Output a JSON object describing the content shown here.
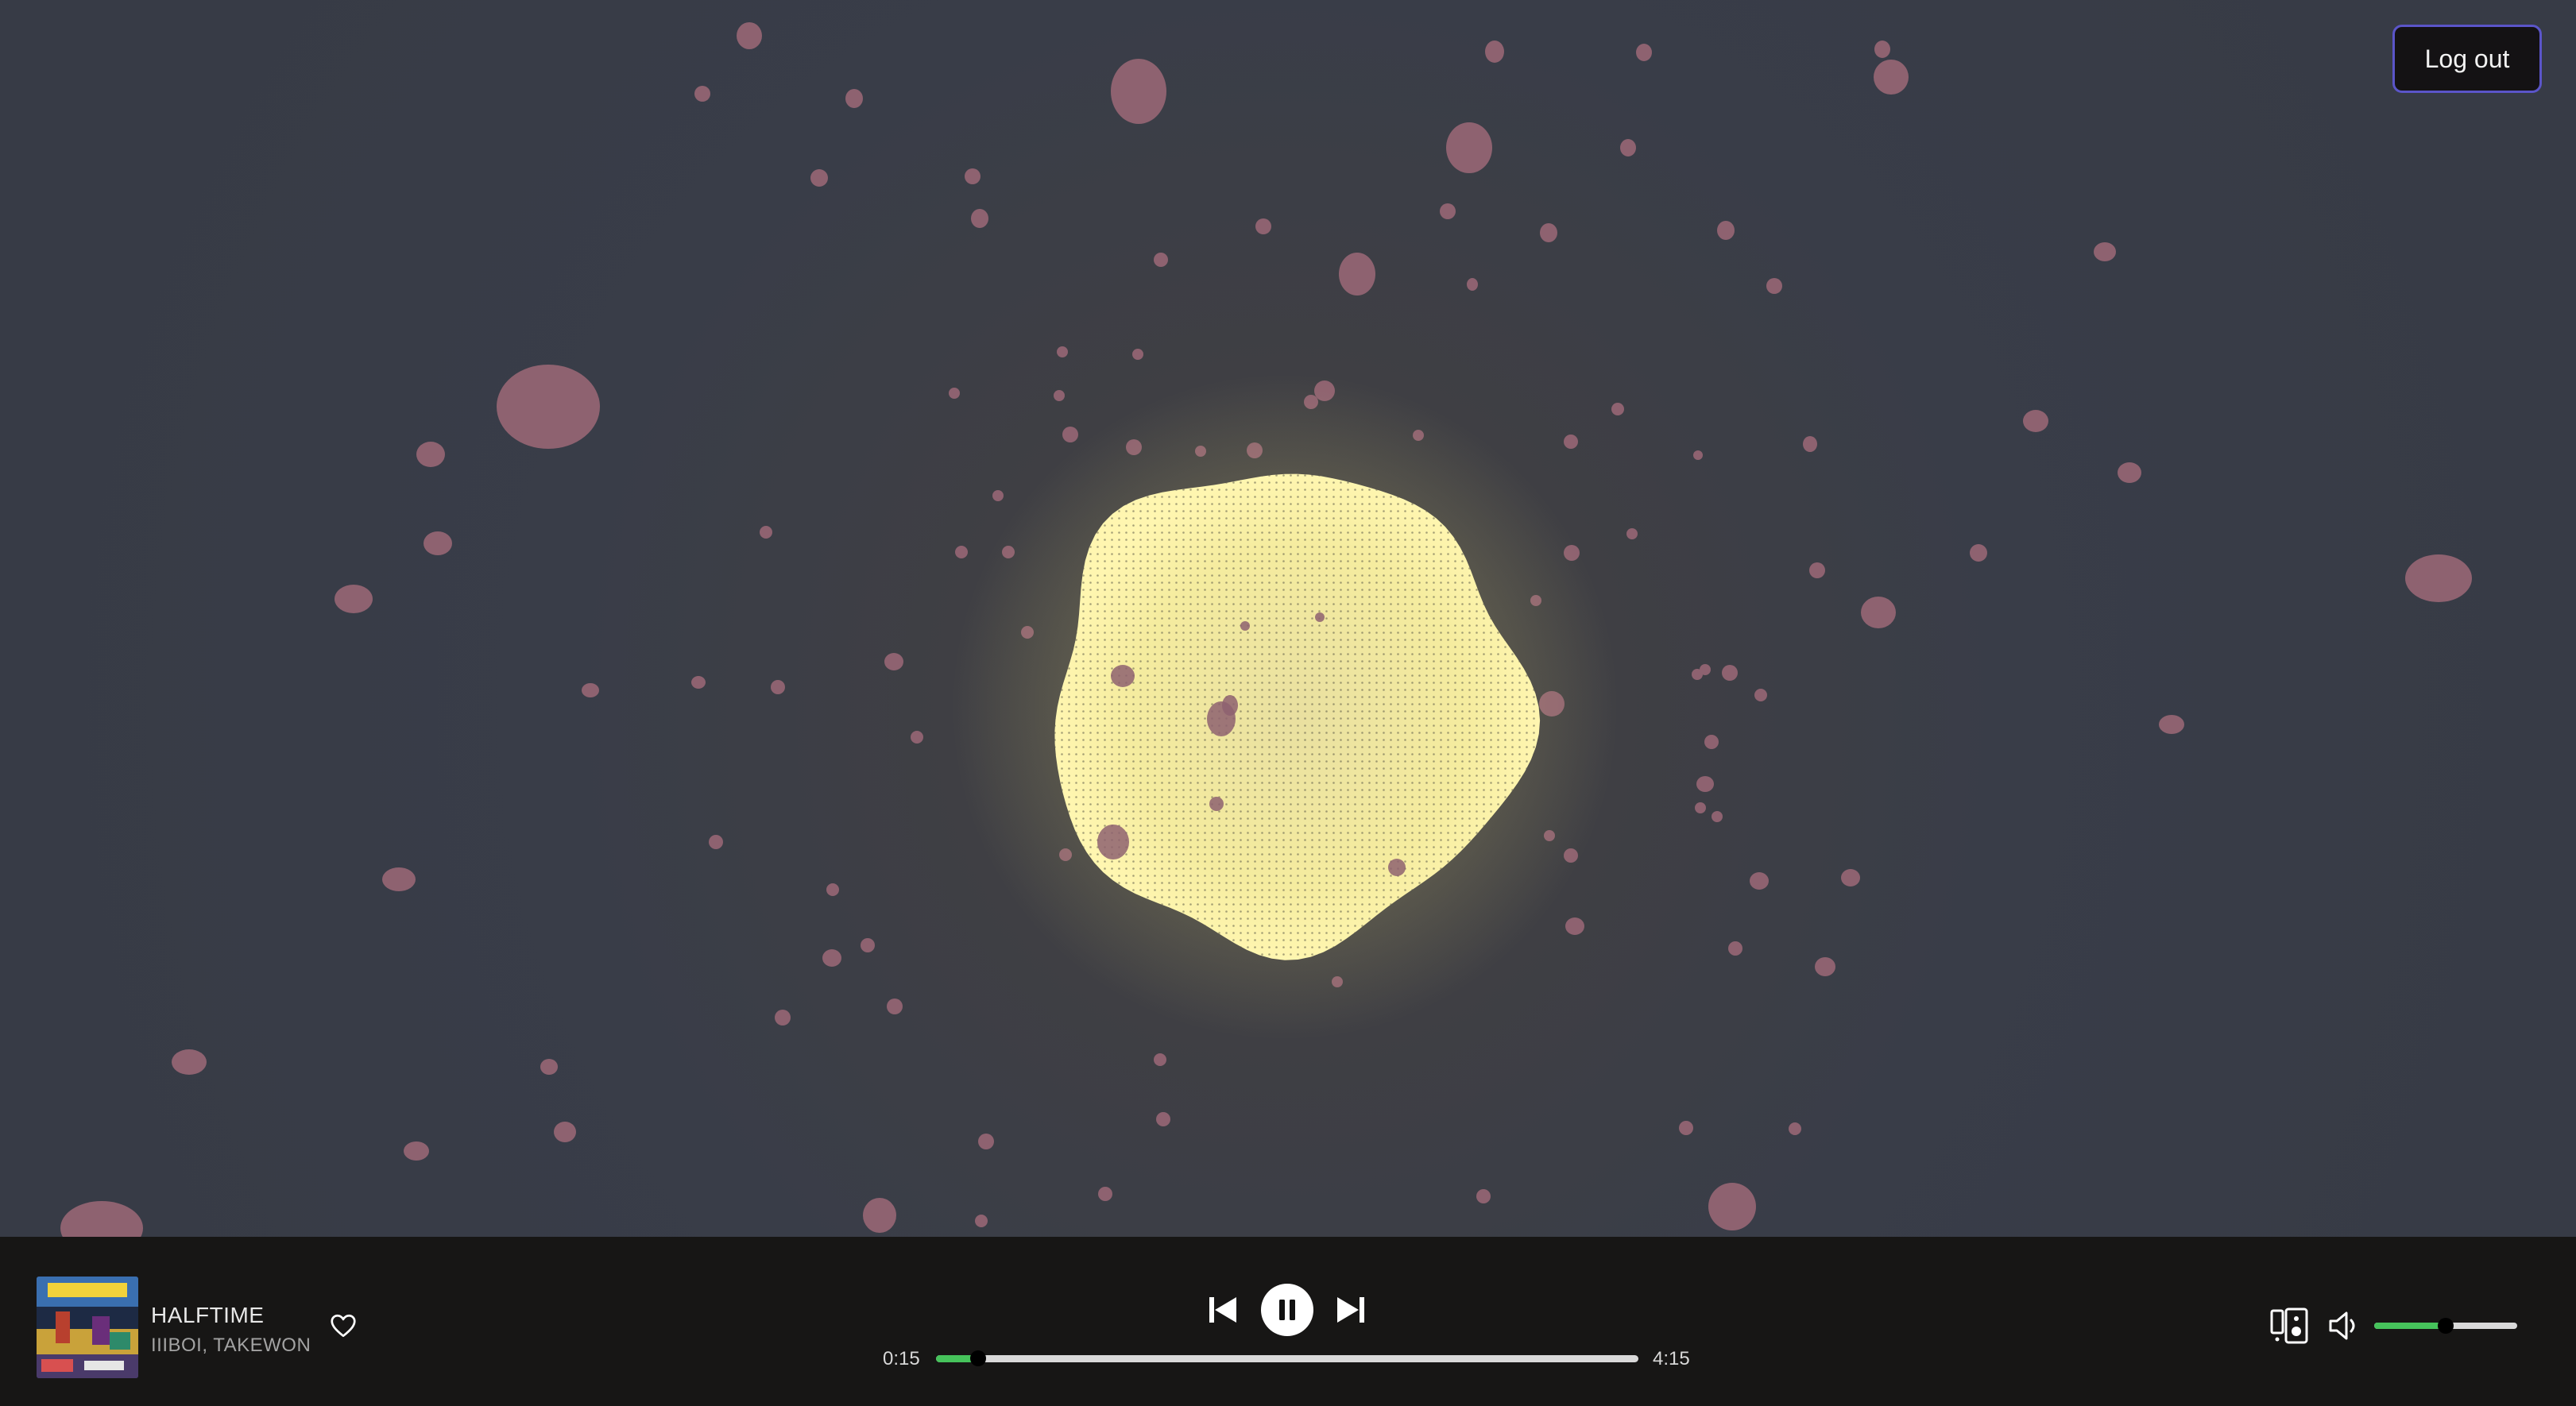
{
  "header": {
    "logout_label": "Log out"
  },
  "now_playing": {
    "title": "HALFTIME",
    "artists": "IIIBOI, TAKEWON",
    "liked": false
  },
  "playback": {
    "is_playing": true,
    "elapsed": "0:15",
    "duration": "4:15",
    "progress_fraction": 0.06
  },
  "volume": {
    "level_fraction": 0.5,
    "muted": false
  },
  "icons": {
    "like": "heart-icon",
    "previous": "skip-previous-icon",
    "play_pause": "pause-icon",
    "next": "skip-next-icon",
    "devices": "connect-device-icon",
    "volume": "speaker-icon"
  },
  "colors": {
    "accent_green": "#46c35b",
    "player_bar": "#171615",
    "background": "#393d48",
    "orb": "#fdf3a2",
    "particles": "#8e6270",
    "logout_border": "#5b55c9"
  }
}
